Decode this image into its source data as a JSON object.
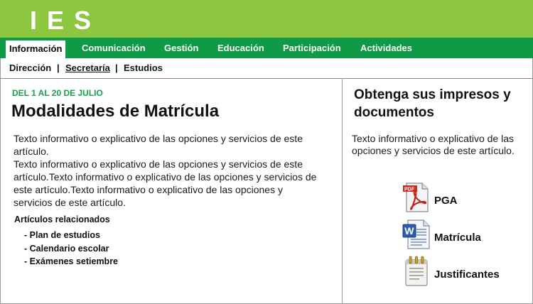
{
  "header": {
    "logo": "IES"
  },
  "main_nav": {
    "items": [
      {
        "label": "Información",
        "active": true
      },
      {
        "label": "Comunicación"
      },
      {
        "label": "Gestión"
      },
      {
        "label": "Educación"
      },
      {
        "label": "Participación"
      },
      {
        "label": "Actividades"
      }
    ]
  },
  "sub_nav": {
    "items": [
      {
        "label": "Dirección"
      },
      {
        "label": "Secretaría",
        "current": true
      },
      {
        "label": "Estudios"
      }
    ],
    "separator": "|"
  },
  "article": {
    "date": "DEL 1 AL 20 DE JULIO",
    "title": "Modalidades de Matrícula",
    "paragraph_1": "Texto informativo o explicativo de las opciones y servicios de este artículo.",
    "paragraph_2": "Texto informativo o explicativo de las opciones y servicios de este artículo.Texto informativo o explicativo de las opciones y servicios de este artículo.Texto informativo o explicativo de las opciones y servicios de este artículo.",
    "related_title": "Artículos relacionados",
    "related": [
      "- Plan de estudios",
      "- Calendario escolar",
      "- Exámenes setiembre"
    ]
  },
  "sidebar": {
    "title": "Obtenga sus impresos y documentos",
    "text": "Texto informativo o explicativo de las opciones y servicios de este artículo.",
    "documents": [
      {
        "label": "PGA",
        "icon": "pdf-icon"
      },
      {
        "label": "Matrícula",
        "icon": "word-document-icon"
      },
      {
        "label": "Justificantes",
        "icon": "notepad-icon"
      }
    ]
  },
  "colors": {
    "header_green": "#8dc63f",
    "nav_green": "#0f9a45",
    "date_green": "#1aa04a"
  }
}
